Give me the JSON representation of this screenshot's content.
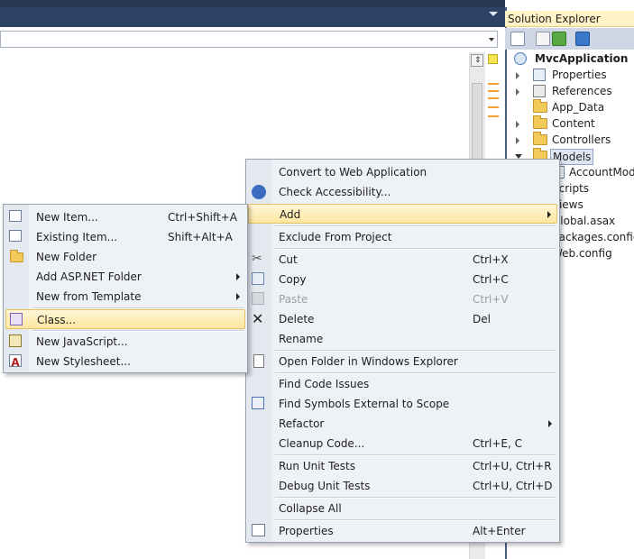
{
  "solution_explorer": {
    "title": "Solution Explorer",
    "project": "MvcApplication",
    "items": [
      {
        "label": "Properties"
      },
      {
        "label": "References"
      },
      {
        "label": "App_Data"
      },
      {
        "label": "Content"
      },
      {
        "label": "Controllers"
      },
      {
        "label": "Models"
      },
      {
        "label": "AccountModels.cs"
      },
      {
        "label": "Scripts"
      },
      {
        "label": "Views"
      },
      {
        "label": "Global.asax"
      },
      {
        "label": "packages.config"
      },
      {
        "label": "Web.config"
      }
    ]
  },
  "context_menu": {
    "items": [
      {
        "label": "Convert to Web Application",
        "shortcut": ""
      },
      {
        "label": "Check Accessibility...",
        "shortcut": ""
      },
      {
        "label": "Add",
        "shortcut": ""
      },
      {
        "label": "Exclude From Project",
        "shortcut": ""
      },
      {
        "label": "Cut",
        "shortcut": "Ctrl+X"
      },
      {
        "label": "Copy",
        "shortcut": "Ctrl+C"
      },
      {
        "label": "Paste",
        "shortcut": "Ctrl+V"
      },
      {
        "label": "Delete",
        "shortcut": "Del"
      },
      {
        "label": "Rename",
        "shortcut": ""
      },
      {
        "label": "Open Folder in Windows Explorer",
        "shortcut": ""
      },
      {
        "label": "Find Code Issues",
        "shortcut": ""
      },
      {
        "label": "Find Symbols External to Scope",
        "shortcut": ""
      },
      {
        "label": "Refactor",
        "shortcut": ""
      },
      {
        "label": "Cleanup Code...",
        "shortcut": "Ctrl+E, C"
      },
      {
        "label": "Run Unit Tests",
        "shortcut": "Ctrl+U, Ctrl+R"
      },
      {
        "label": "Debug Unit Tests",
        "shortcut": "Ctrl+U, Ctrl+D"
      },
      {
        "label": "Collapse All",
        "shortcut": ""
      },
      {
        "label": "Properties",
        "shortcut": "Alt+Enter"
      }
    ]
  },
  "add_submenu": {
    "items": [
      {
        "label": "New Item...",
        "shortcut": "Ctrl+Shift+A"
      },
      {
        "label": "Existing Item...",
        "shortcut": "Shift+Alt+A"
      },
      {
        "label": "New Folder",
        "shortcut": ""
      },
      {
        "label": "Add ASP.NET Folder",
        "shortcut": ""
      },
      {
        "label": "New from Template",
        "shortcut": ""
      },
      {
        "label": "Class...",
        "shortcut": ""
      },
      {
        "label": "New JavaScript...",
        "shortcut": ""
      },
      {
        "label": "New Stylesheet...",
        "shortcut": ""
      }
    ]
  },
  "colors": {
    "menu_background": "#eef1f6",
    "highlight": "#fde6a0",
    "title_bar": "#2d4265",
    "se_header": "#fff3c7"
  }
}
